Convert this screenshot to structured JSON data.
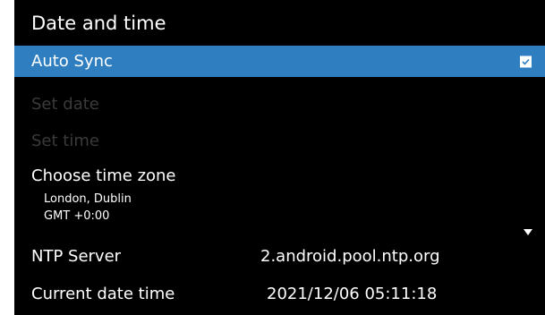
{
  "header": {
    "title": "Date and time"
  },
  "items": {
    "auto_sync": {
      "label": "Auto Sync",
      "checked": true
    },
    "set_date": {
      "label": "Set date"
    },
    "set_time": {
      "label": "Set time"
    },
    "time_zone": {
      "label": "Choose time zone",
      "city": "London, Dublin",
      "offset": "GMT +0:00"
    },
    "ntp_server": {
      "label": "NTP Server",
      "value": "2.android.pool.ntp.org"
    },
    "current_date_time": {
      "label": "Current date time",
      "value": "2021/12/06 05:11:18"
    }
  },
  "colors": {
    "accent": "#2f7ec0",
    "background": "#000000",
    "disabled": "#3a3a3a"
  }
}
